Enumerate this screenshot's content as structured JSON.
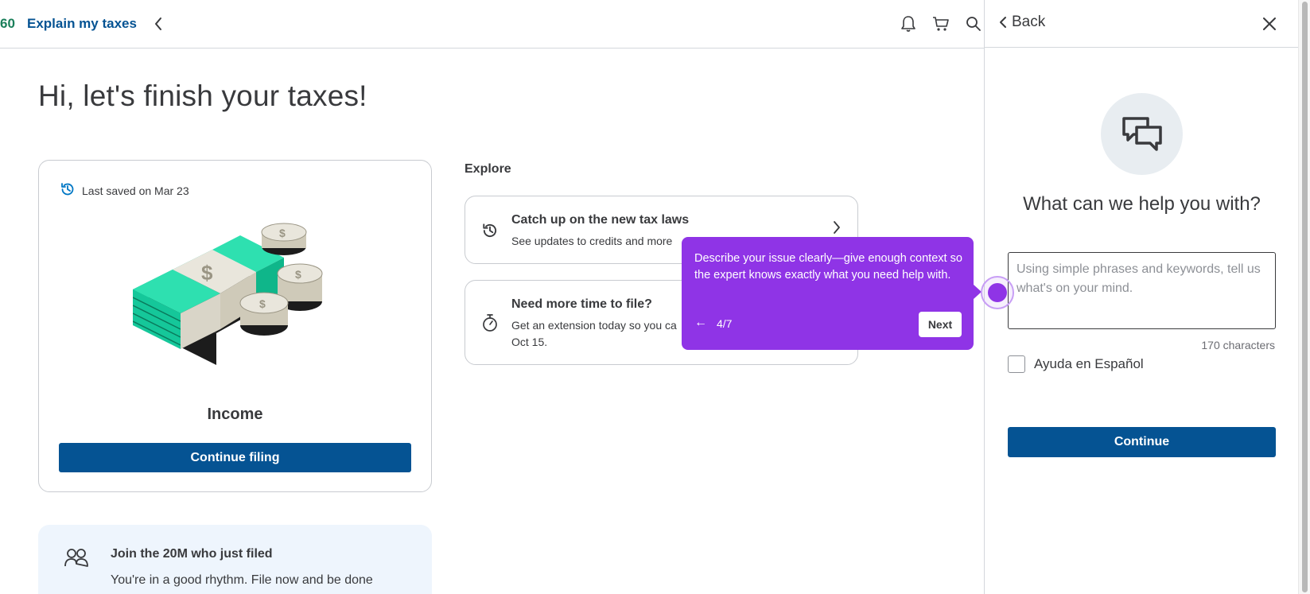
{
  "topbar": {
    "brand_fragment": "60",
    "explain_link": "Explain my taxes",
    "icons": [
      "chevron-left-icon",
      "bell-icon",
      "cart-icon",
      "search-icon"
    ]
  },
  "main": {
    "title": "Hi, let's finish your taxes!",
    "income_card": {
      "saved_text": "Last saved on Mar 23",
      "label": "Income",
      "button": "Continue filing"
    },
    "join_card": {
      "title": "Join the 20M who just filed",
      "text": "You're in a good rhythm. File now and be done"
    },
    "explore": {
      "heading": "Explore",
      "cards": [
        {
          "title": "Catch up on the new tax laws",
          "desc": [
            "See updates to credits and more"
          ],
          "icon": "history-clock-icon"
        },
        {
          "title": "Need more time to file?",
          "desc": [
            "Get an extension today so you ca",
            "Oct 15."
          ],
          "icon": "stopwatch-icon"
        }
      ]
    }
  },
  "tooltip": {
    "text": "Describe your issue clearly—give enough context so the expert knows exactly what you need help with.",
    "back": "←",
    "step": "4/7",
    "next": "Next"
  },
  "panel": {
    "back": "Back",
    "heading": "What can we help you with?",
    "textarea_placeholder": "Using simple phrases and keywords, tell us what's on your mind.",
    "char_count": "170 characters",
    "spanish_label": "Ayuda en Español",
    "spanish_checked": false,
    "continue": "Continue"
  },
  "colors": {
    "brand_blue": "#055393",
    "brand_green": "#1a7f5a",
    "tooltip_purple": "#8f34e6",
    "text": "#393a3d"
  }
}
